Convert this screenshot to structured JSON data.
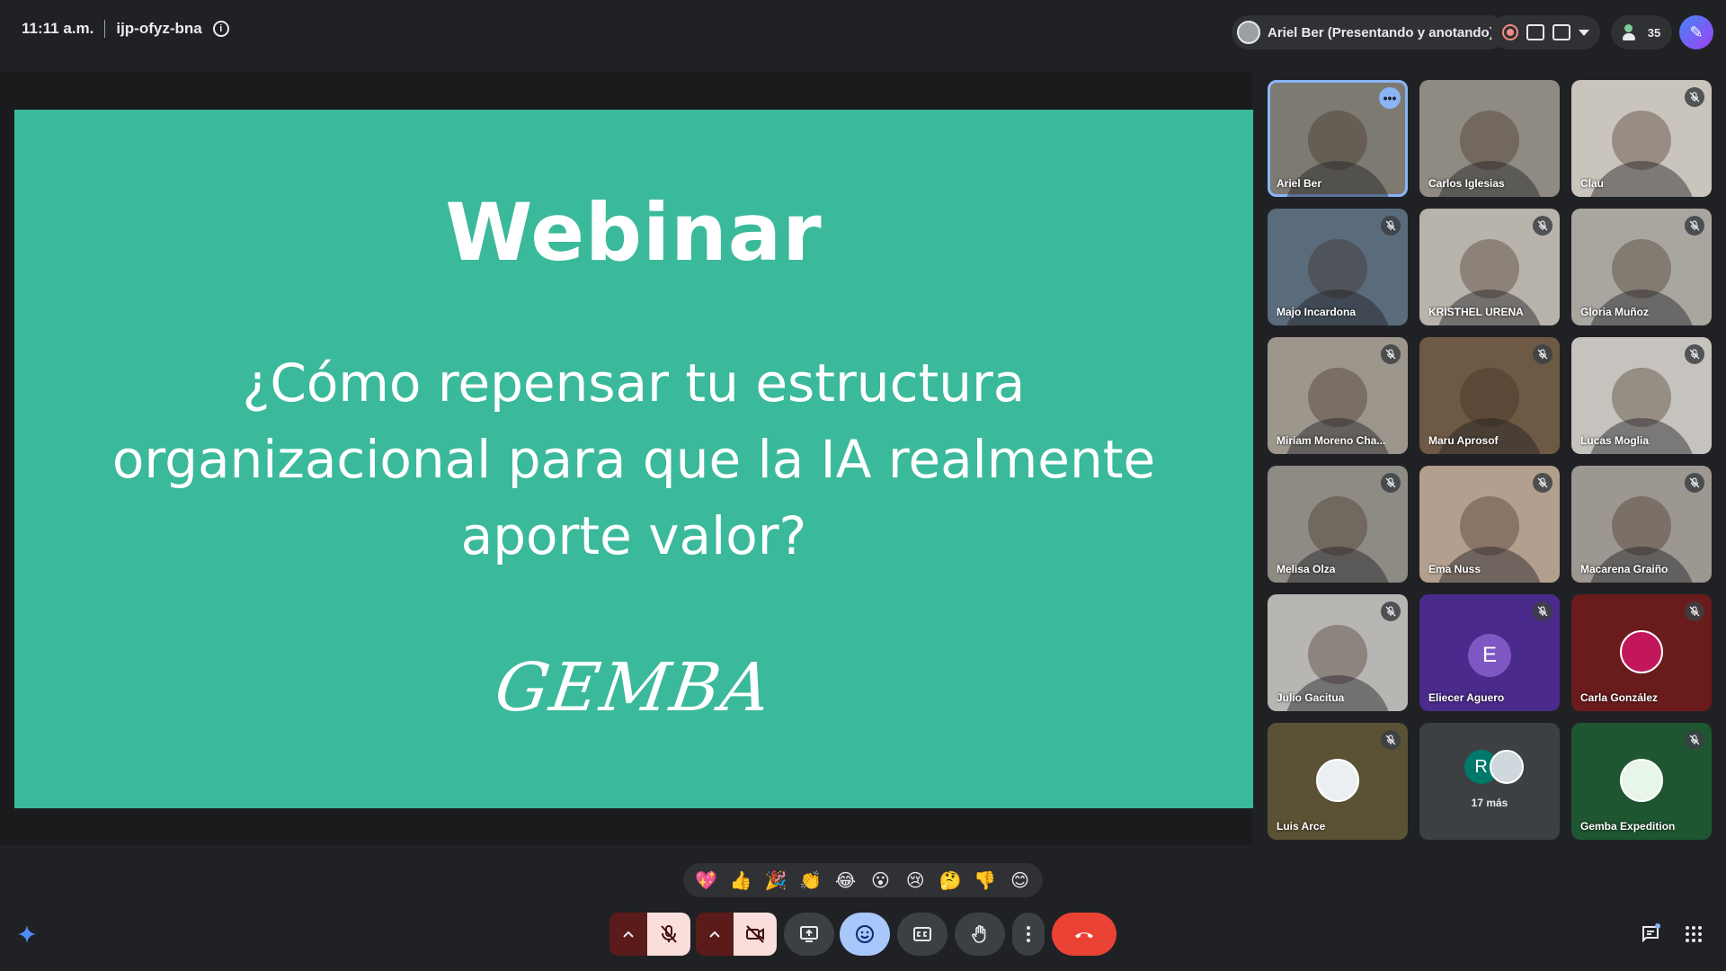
{
  "meeting": {
    "time": "11:11 a.m.",
    "code": "ijp-ofyz-bna",
    "presenter_label": "Ariel Ber (Presentando y anotando)",
    "participant_count": "35"
  },
  "slide": {
    "title": "Webinar",
    "subtitle": "¿Cómo repensar tu estructura organizacional para que la IA realmente aporte valor?",
    "logo_text": "GEMBA"
  },
  "participants": [
    {
      "name": "Ariel Ber",
      "muted": false,
      "active": true,
      "bg": "#7d7a72"
    },
    {
      "name": "Carlos Iglesias",
      "muted": false,
      "active": false,
      "bg": "#8f8a82"
    },
    {
      "name": "Clau",
      "muted": true,
      "active": false,
      "bg": "#c9c4bc"
    },
    {
      "name": "Majo Incardona",
      "muted": true,
      "active": false,
      "bg": "#5a6b7b"
    },
    {
      "name": "KRISTHEL URENA",
      "muted": true,
      "active": false,
      "bg": "#b8b3ab"
    },
    {
      "name": "Gloria Muñoz",
      "muted": true,
      "active": false,
      "bg": "#a9a6a0"
    },
    {
      "name": "Miriam Moreno Cha...",
      "muted": true,
      "active": false,
      "bg": "#9c968c"
    },
    {
      "name": "Maru Aprosof",
      "muted": true,
      "active": false,
      "bg": "#6e5a44"
    },
    {
      "name": "Lucas Moglia",
      "muted": true,
      "active": false,
      "bg": "#c6c3be"
    },
    {
      "name": "Melisa Olza",
      "muted": true,
      "active": false,
      "bg": "#8e8a84"
    },
    {
      "name": "Ema Nuss",
      "muted": true,
      "active": false,
      "bg": "#b39f8e"
    },
    {
      "name": "Macarena Graiño",
      "muted": true,
      "active": false,
      "bg": "#9c9790"
    },
    {
      "name": "Julio Gacitua",
      "muted": true,
      "active": false,
      "bg": "#b8b6b2"
    },
    {
      "name": "Eliecer Aguero",
      "muted": true,
      "active": false,
      "bg": "#4a2a8a",
      "letter": "E",
      "letter_bg": "#7e57c2"
    },
    {
      "name": "Carla González",
      "muted": true,
      "active": false,
      "bg": "#6a1b1b"
    },
    {
      "name": "Luis Arce",
      "muted": true,
      "active": false,
      "bg": "#5b5235"
    },
    {
      "name": "",
      "muted": false,
      "active": false,
      "bg": "#3c4043",
      "more_label": "17 más",
      "letter": "R",
      "letter_bg": "#00796b"
    },
    {
      "name": "Gemba Expedition",
      "muted": true,
      "active": false,
      "bg": "#1e5631"
    }
  ],
  "reactions": [
    "💖",
    "👍",
    "🎉",
    "👏",
    "😂",
    "😮",
    "😢",
    "🤔",
    "👎",
    "😊"
  ],
  "colors": {
    "slide_bg": "#3bb99b",
    "page_bg": "#202124",
    "end_call": "#ea4335",
    "muted_btn": "#f9dedc",
    "accent": "#8ab4f8"
  }
}
